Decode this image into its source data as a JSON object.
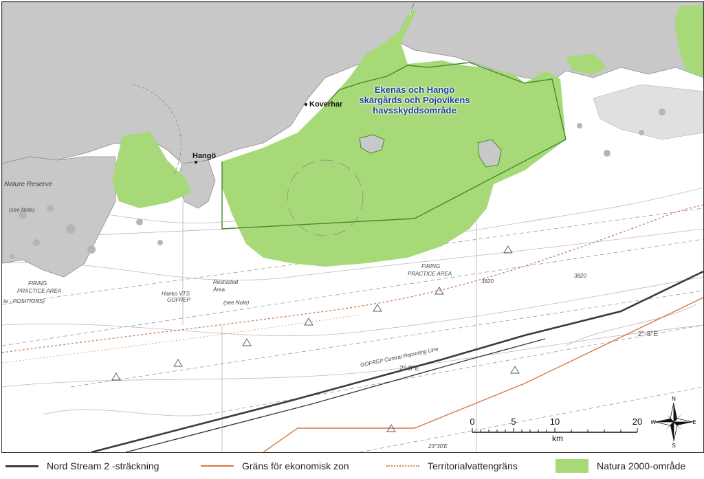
{
  "colors": {
    "land": "#c8c8c8",
    "water": "#ffffff",
    "natura": "#a8d978",
    "natura_edge": "#3f8a2e",
    "pipeline": "#3a3a3a",
    "eez": "#d9773a",
    "territorial": "#c9865a",
    "area_label": "#1b3f8f"
  },
  "places": {
    "koverhar": "Koverhar",
    "hango": "Hangö"
  },
  "protected_area": {
    "line1": "Ekenäs och Hangö",
    "line2": "skärgårds och Pojovikens",
    "line3": "havsskyddsområde"
  },
  "chart_labels": {
    "nature_reserve": "Nature Reserve",
    "see_note_1": "(see Note)",
    "firing_1": "FIRING",
    "practice_1": "PRACTICE AREA",
    "positions": "te - POSITIONS)",
    "firing_2": "FIRING",
    "practice_2": "PRACTICE AREA",
    "restricted": "Restricted",
    "area": "Area",
    "see_note_2": "(see Note)",
    "depth_3820_a": "3820",
    "depth_3820_b": "3820",
    "variation_1": "2°-8°E",
    "variation_2": "2°-8°E",
    "hanko_vts": "Hanko VTS",
    "gofrep": "GOFREP",
    "gofrep_line": "GOFREP Central Reporting Line",
    "lat_label": "23°30'E"
  },
  "scale": {
    "ticks": [
      "0",
      "5",
      "10",
      "20"
    ],
    "unit": "km"
  },
  "compass": {
    "n": "N",
    "s": "S",
    "e": "E",
    "w": "W"
  },
  "legend": {
    "pipeline": "Nord Stream 2 -sträckning",
    "eez": "Gräns för ekonomisk zon",
    "territorial": "Territorialvattengräns",
    "natura": "Natura 2000-område"
  }
}
